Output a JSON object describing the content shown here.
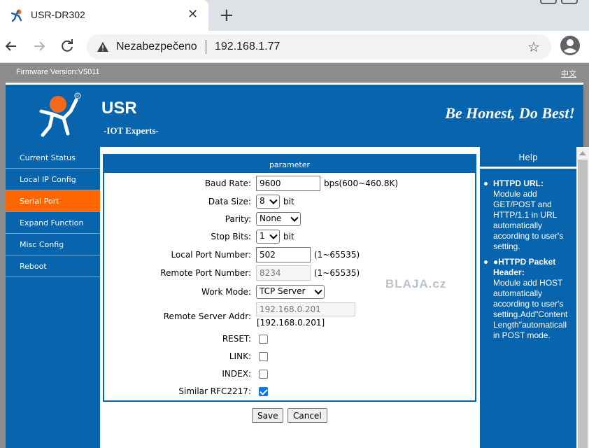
{
  "browser": {
    "tab_title": "USR-DR302",
    "tab_close": "✕",
    "new_tab": "+",
    "not_secure": "Nezabezpečeno",
    "url": "192.168.1.77",
    "star": "☆"
  },
  "page": {
    "firmware": "Firmware Version:V5011",
    "lang_link": "中文",
    "brand": "USR",
    "brand_sub": "-IOT Experts-",
    "slogan": "Be Honest, Do Best!",
    "watermark": "BLAJA.cz"
  },
  "sidebar": {
    "items": [
      {
        "label": "Current Status"
      },
      {
        "label": "Local IP Config"
      },
      {
        "label": "Serial Port"
      },
      {
        "label": "Expand Function"
      },
      {
        "label": "Misc Config"
      },
      {
        "label": "Reboot"
      }
    ],
    "active": "Serial Port"
  },
  "form": {
    "title": "parameter",
    "baud_label": "Baud Rate:",
    "baud_value": "9600",
    "baud_hint": "bps(600~460.8K)",
    "datasize_label": "Data Size:",
    "datasize_value": "8",
    "datasize_hint": "bit",
    "parity_label": "Parity:",
    "parity_value": "None",
    "stopbits_label": "Stop Bits:",
    "stopbits_value": "1",
    "stopbits_hint": "bit",
    "localport_label": "Local Port Number:",
    "localport_value": "502",
    "localport_hint": "(1~65535)",
    "remoteport_label": "Remote Port Number:",
    "remoteport_value": "8234",
    "remoteport_hint": "(1~65535)",
    "workmode_label": "Work Mode:",
    "workmode_value": "TCP Server",
    "remoteaddr_label": "Remote Server Addr:",
    "remoteaddr_value": "192.168.0.201",
    "remoteaddr_note": "[192.168.0.201]",
    "reset_label": "RESET:",
    "reset_checked": false,
    "link_label": "LINK:",
    "link_checked": false,
    "index_label": "INDEX:",
    "index_checked": false,
    "rfc_label": "Similar RFC2217:",
    "rfc_checked": true,
    "save": "Save",
    "cancel": "Cancel"
  },
  "help": {
    "title": "Help",
    "items": [
      {
        "head": "HTTPD URL:",
        "text": "Module add\nGET/POST and\nHTTP/1.1 in URL\nautomatically\naccording to user's\nsetting."
      },
      {
        "head": "●HTTPD Packet\nHeader:",
        "text": "Module add HOST\nautomatically\naccording to user's\nsetting.Add\"Content\nLength\"automaticall\nin POST mode."
      }
    ]
  },
  "colors": {
    "brand_blue": "#0864ad",
    "active_orange": "#ff6600",
    "gray_bar": "#8c8c8c"
  }
}
